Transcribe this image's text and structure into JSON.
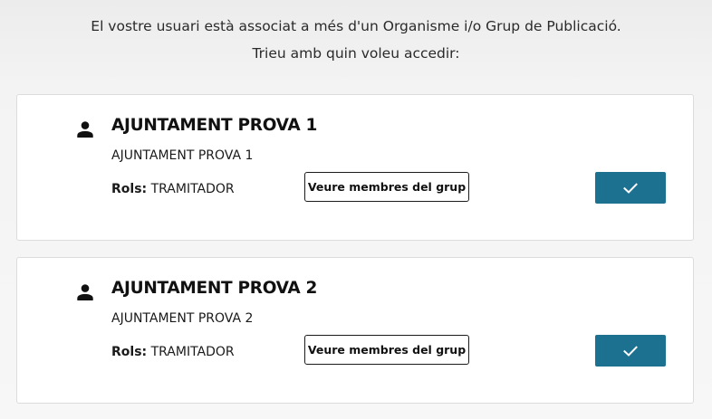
{
  "intro": {
    "line1": "El vostre usuari està associat a més d'un Organisme i/o Grup de Publicació.",
    "line2": "Trieu amb quin voleu accedir:"
  },
  "organizations": [
    {
      "title": "AJUNTAMENT PROVA 1",
      "subtitle": "AJUNTAMENT PROVA 1",
      "roles_label": "Rols:",
      "roles_value": "TRAMITADOR",
      "members_button": "Veure membres del grup",
      "icon": "user-icon",
      "confirm_icon": "check-icon"
    },
    {
      "title": "AJUNTAMENT PROVA 2",
      "subtitle": "AJUNTAMENT PROVA 2",
      "roles_label": "Rols:",
      "roles_value": "TRAMITADOR",
      "members_button": "Veure membres del grup",
      "icon": "user-icon",
      "confirm_icon": "check-icon"
    }
  ],
  "colors": {
    "accent": "#1c7191",
    "card_background": "#ffffff",
    "page_background": "#f3f3f3"
  }
}
